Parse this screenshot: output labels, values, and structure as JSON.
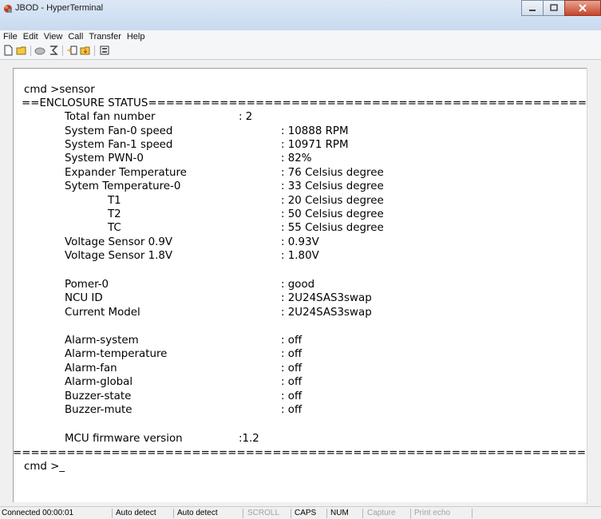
{
  "window": {
    "title": "JBOD - HyperTerminal"
  },
  "menu": {
    "items": [
      "File",
      "Edit",
      "View",
      "Call",
      "Transfer",
      "Help"
    ]
  },
  "toolbar": {
    "icons": [
      "new-icon",
      "open-icon",
      "phone-icon",
      "disconnect-icon",
      "send-icon",
      "receive-icon",
      "properties-icon"
    ]
  },
  "terminal": {
    "prompt": "cmd >sensor",
    "header": "==ENCLOSURE STATUS==========================================================",
    "fan_count": {
      "label": "Total fan number",
      "value": ": 2"
    },
    "readings": [
      {
        "label": "System Fan-0 speed",
        "value": ": 10888 RPM",
        "indent": 1
      },
      {
        "label": "System Fan-1 speed",
        "value": ": 10971 RPM",
        "indent": 1
      },
      {
        "label": "System PWN-0",
        "value": ": 82%",
        "indent": 1
      },
      {
        "label": "Expander Temperature",
        "value": ": 76 Celsius degree",
        "indent": 1
      },
      {
        "label": "Sytem Temperature-0",
        "value": ": 33 Celsius degree",
        "indent": 1
      },
      {
        "label": "T1",
        "value": ": 20 Celsius degree",
        "indent": 2
      },
      {
        "label": "T2",
        "value": ": 50 Celsius degree",
        "indent": 2
      },
      {
        "label": "TC",
        "value": ": 55 Celsius degree",
        "indent": 2
      },
      {
        "label": "Voltage Sensor 0.9V",
        "value": ": 0.93V",
        "indent": 1
      },
      {
        "label": "Voltage Sensor 1.8V",
        "value": ": 1.80V",
        "indent": 1
      }
    ],
    "status": [
      {
        "label": "Pomer-0",
        "value": ": good"
      },
      {
        "label": "NCU ID",
        "value": ": 2U24SAS3swap"
      },
      {
        "label": "Current Model",
        "value": ": 2U24SAS3swap"
      }
    ],
    "alarms": [
      {
        "label": "Alarm-system",
        "value": ": off"
      },
      {
        "label": "Alarm-temperature",
        "value": ": off"
      },
      {
        "label": "Alarm-fan",
        "value": ": off"
      },
      {
        "label": "Alarm-global",
        "value": ": off"
      },
      {
        "label": "Buzzer-state",
        "value": ": off"
      },
      {
        "label": "Buzzer-mute",
        "value": ": off"
      }
    ],
    "firmware": {
      "label": "MCU firmware version",
      "value": ":1.2"
    },
    "footer": "==============================================================================",
    "final_prompt": "cmd >",
    "cursor": "_"
  },
  "statusbar": {
    "items": [
      {
        "text": "Connected 00:00:01",
        "active": true
      },
      {
        "text": "Auto detect",
        "active": true
      },
      {
        "text": "Auto detect",
        "active": true
      },
      {
        "text": "SCROLL",
        "active": false
      },
      {
        "text": "CAPS",
        "active": true
      },
      {
        "text": "NUM",
        "active": true
      },
      {
        "text": "Capture",
        "active": false
      },
      {
        "text": "Print echo",
        "active": false
      }
    ]
  }
}
